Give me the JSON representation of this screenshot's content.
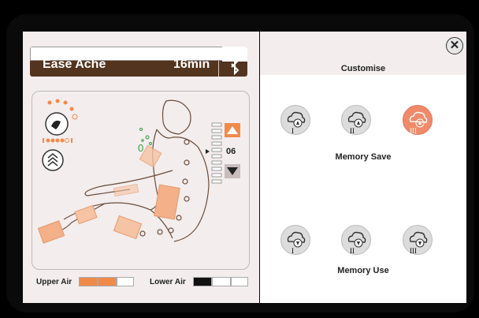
{
  "program": {
    "name": "Ease Ache",
    "time": "16min"
  },
  "customise_title": "Customise",
  "memory": {
    "save_label": "Memory Save",
    "use_label": "Memory Use",
    "save_slots": [
      "I",
      "II",
      "III"
    ],
    "use_slots": [
      "I",
      "II",
      "III"
    ],
    "active_save_slot": "III"
  },
  "intensity": {
    "value": "06"
  },
  "air": {
    "upper_label": "Upper Air",
    "lower_label": "Lower Air",
    "upper_level": 2,
    "lower_level": 1,
    "levels": 3
  },
  "zone_label": "0",
  "colors": {
    "accent": "#f08a4b",
    "brand_brown": "#53341f",
    "dark": "#111111"
  },
  "icons": [
    "close-icon",
    "bluetooth-icon",
    "cloud-save-icon",
    "cloud-use-icon",
    "massage-mode-icon",
    "airbag-icon",
    "arrow-up-icon",
    "arrow-down-icon"
  ]
}
